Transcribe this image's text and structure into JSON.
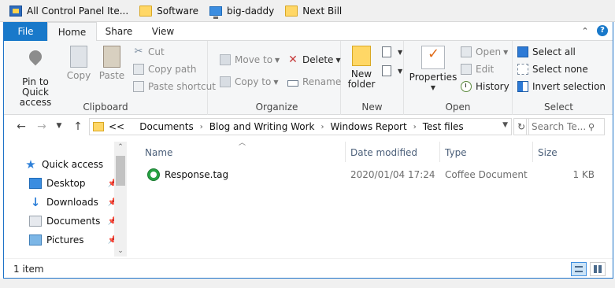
{
  "bookmarks": [
    {
      "label": "All Control Panel Ite...",
      "icon": "control-panel-icon"
    },
    {
      "label": "Software",
      "icon": "folder-icon"
    },
    {
      "label": "big-daddy",
      "icon": "monitor-icon"
    },
    {
      "label": "Next Bill",
      "icon": "folder-icon"
    }
  ],
  "ribbon_tabs": {
    "file": "File",
    "home": "Home",
    "share": "Share",
    "view": "View",
    "help": "?"
  },
  "clipboard": {
    "pin": "Pin to Quick access",
    "copy": "Copy",
    "paste": "Paste",
    "cut": "Cut",
    "copy_path": "Copy path",
    "paste_shortcut": "Paste shortcut",
    "label": "Clipboard"
  },
  "organize": {
    "move_to": "Move to",
    "copy_to": "Copy to",
    "delete": "Delete",
    "rename": "Rename",
    "label": "Organize"
  },
  "new_group": {
    "new_folder": "New folder",
    "label": "New"
  },
  "open_group": {
    "properties": "Properties",
    "open": "Open",
    "edit": "Edit",
    "history": "History",
    "label": "Open"
  },
  "select_group": {
    "select_all": "Select all",
    "select_none": "Select none",
    "invert": "Invert selection",
    "label": "Select"
  },
  "address": {
    "overflow": "<<",
    "crumbs": [
      "Documents",
      "Blog and Writing Work",
      "Windows Report",
      "Test files"
    ]
  },
  "search": {
    "placeholder": "Search Te..."
  },
  "nav_pane": {
    "quick_access": "Quick access",
    "items": [
      "Desktop",
      "Downloads",
      "Documents",
      "Pictures"
    ]
  },
  "columns": {
    "name": "Name",
    "date": "Date modified",
    "type": "Type",
    "size": "Size"
  },
  "files": [
    {
      "name": "Response.tag",
      "date": "2020/01/04 17:24",
      "type": "Coffee Document",
      "size": "1 KB"
    }
  ],
  "status": {
    "count": "1 item"
  },
  "colors": {
    "accent": "#1979ca",
    "window_border": "#1e73c8"
  }
}
